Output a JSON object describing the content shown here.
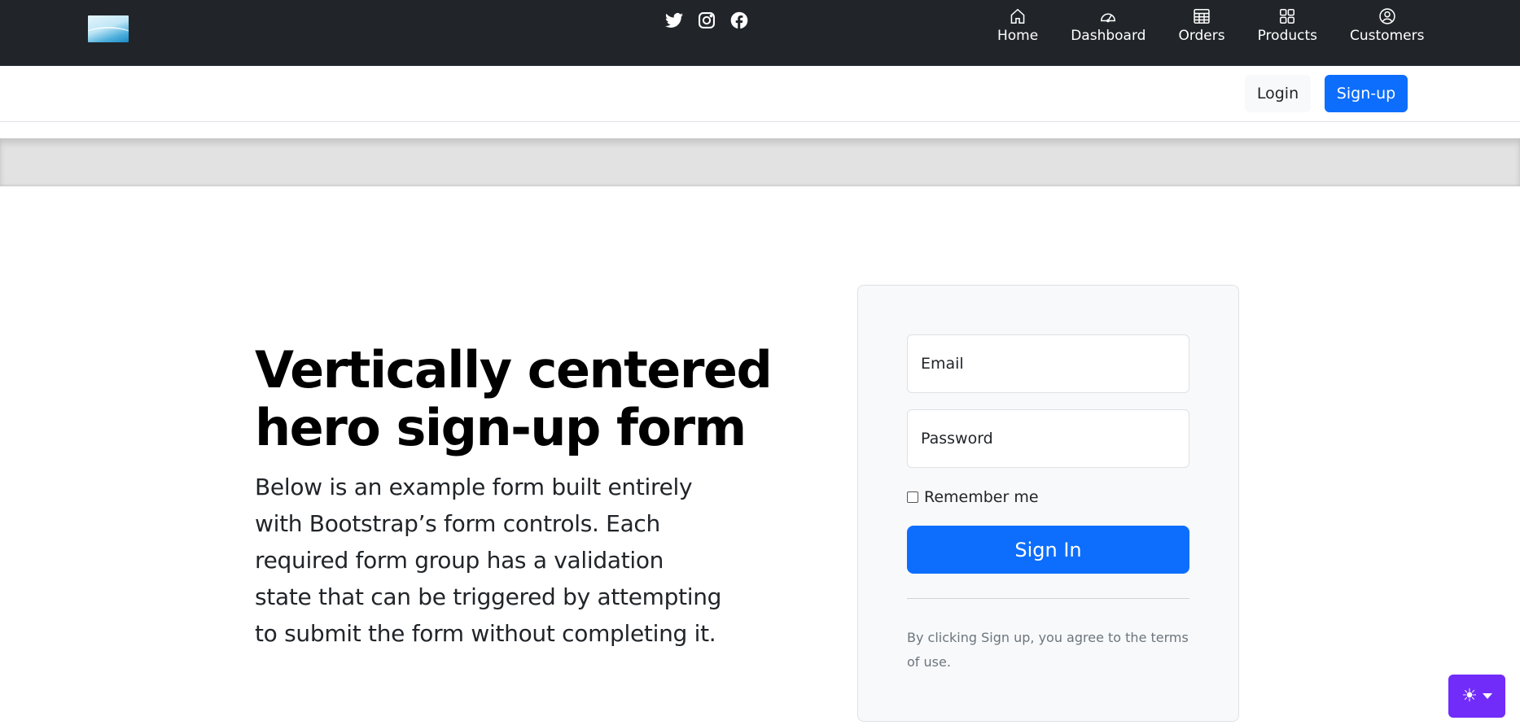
{
  "header": {
    "social": [
      {
        "icon": "twitter-icon"
      },
      {
        "icon": "instagram-icon"
      },
      {
        "icon": "facebook-icon"
      }
    ],
    "nav": [
      {
        "label": "Home",
        "icon": "home-icon"
      },
      {
        "label": "Dashboard",
        "icon": "speedometer-icon"
      },
      {
        "label": "Orders",
        "icon": "table-icon"
      },
      {
        "label": "Products",
        "icon": "grid-icon"
      },
      {
        "label": "Customers",
        "icon": "person-circle-icon"
      }
    ]
  },
  "subheader": {
    "login_label": "Login",
    "signup_label": "Sign-up"
  },
  "hero": {
    "title": "Vertically centered hero sign-up form",
    "description": "Below is an example form built entirely with Bootstrap’s form controls. Each required form group has a validation state that can be triggered by attempting to submit the form without completing it."
  },
  "form": {
    "email_placeholder": "Email",
    "password_placeholder": "Password",
    "remember_label": "Remember me",
    "submit_label": "Sign In",
    "terms": "By clicking Sign up, you agree to the terms of use."
  },
  "theme_toggle": {
    "icon": "sun-icon"
  },
  "colors": {
    "navbar_bg": "#212529",
    "primary": "#0d6efd",
    "theme_toggle_bg": "#712cf9"
  }
}
